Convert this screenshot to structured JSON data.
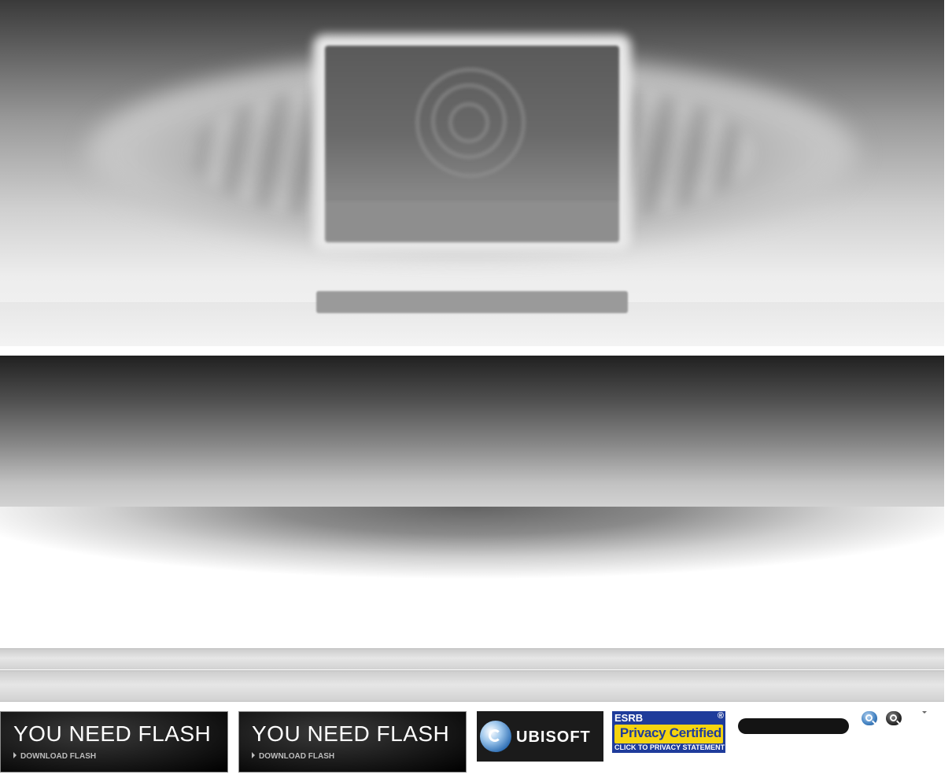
{
  "flash_promos": [
    {
      "title": "YOU NEED FLASH",
      "link": "DOWNLOAD FLASH"
    },
    {
      "title": "YOU NEED FLASH",
      "link": "DOWNLOAD FLASH"
    }
  ],
  "footer": {
    "ubisoft_logo_text": "UBISOFT",
    "esrb": {
      "tag": "ESRB",
      "badge": "Privacy Certified",
      "sub": "CLICK TO PRIVACY STATEMENT",
      "registered_mark": "®"
    }
  },
  "search": {
    "placeholder": ""
  },
  "icons": {
    "search_blue": "magnifier-icon",
    "search_dark": "magnifier-icon",
    "dropdown": "caret-down-icon"
  },
  "colors": {
    "esrb_blue": "#1f3c9b",
    "esrb_yellow": "#f5d40f",
    "ubisoft_bg": "#1b1b1b",
    "search_bg": "#141414"
  }
}
